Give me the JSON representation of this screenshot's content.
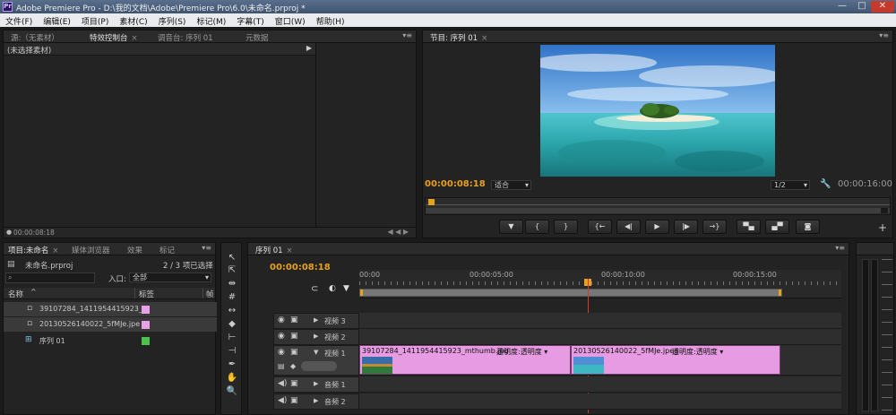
{
  "window": {
    "title": "Adobe Premiere Pro - D:\\我的文档\\Adobe\\Premiere Pro\\6.0\\未命名.prproj *",
    "logo": "Pr"
  },
  "menu": [
    "文件(F)",
    "编辑(E)",
    "项目(P)",
    "素材(C)",
    "序列(S)",
    "标记(M)",
    "字幕(T)",
    "窗口(W)",
    "帮助(H)"
  ],
  "effects_panel": {
    "tabs": [
      "源:（无素材）",
      "特效控制台",
      "调音台: 序列 01",
      "元数据"
    ],
    "active_tab": "特效控制台",
    "no_clip": "(未选择素材)",
    "timecode": "00:00:08:18"
  },
  "program": {
    "tab": "节目: 序列 01",
    "timecode": "00:00:08:18",
    "fit": "适合",
    "resolution": "1/2",
    "duration": "00:00:16:00",
    "buttons": [
      "marker",
      "in",
      "out",
      "go-in",
      "step-back",
      "play",
      "step-fwd",
      "go-out",
      "lift",
      "extract",
      "export-frame"
    ]
  },
  "project": {
    "tabs": [
      "项目:未命名",
      "媒体浏览器",
      "效果",
      "标记"
    ],
    "filename": "未命名.prproj",
    "selection": "2 / 3 项已选择",
    "search_placeholder": "",
    "in_label": "入口:",
    "in_value": "全部",
    "col_name": "名称",
    "col_label": "标签",
    "col_frame": "帧",
    "items": [
      {
        "name": "39107284_1411954415923_",
        "color": "#e8a0e8"
      },
      {
        "name": "20130526140022_5fMJe.jpe",
        "color": "#e8a0e8"
      },
      {
        "name": "序列 01",
        "color": "#4cc24c"
      }
    ]
  },
  "timeline": {
    "tab": "序列 01",
    "timecode": "00:00:08:18",
    "ruler": [
      "00:00",
      "00:00:05:00",
      "00:00:10:00",
      "00:00:15:00"
    ],
    "tracks": {
      "v3": "视频 3",
      "v2": "视频 2",
      "v1": "视频 1",
      "a1": "音频 1",
      "a2": "音频 2"
    },
    "clips": [
      {
        "name": "39107284_1411954415923_mthumb.jpg",
        "fx": "透明度:透明度 ▾"
      },
      {
        "name": "20130526140022_5fMJe.jpeg",
        "fx": "透明度:透明度 ▾"
      }
    ]
  }
}
